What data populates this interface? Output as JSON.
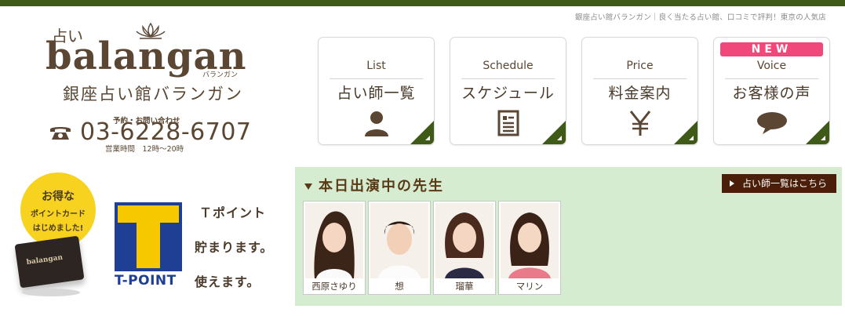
{
  "tagline": "銀座占い館バランガン｜良く当たる占い館、口コミで評判！東京の人気店",
  "logo": {
    "kanji_small": "占い",
    "word": "balangan",
    "kana": "バランガン",
    "jp_name": "銀座占い館バランガン"
  },
  "phone": {
    "label": "予約・お問い合わせ",
    "number": "03-6228-6707",
    "hours": "営業時間　12時～20時",
    "icon": "telephone-icon"
  },
  "nav": [
    {
      "en": "List",
      "jp": "占い師一覧",
      "icon": "person-icon"
    },
    {
      "en": "Schedule",
      "jp": "スケジュール",
      "icon": "document-icon"
    },
    {
      "en": "Price",
      "jp": "料金案内",
      "icon": "yen-icon"
    },
    {
      "en": "Voice",
      "jp": "お客様の声",
      "icon": "speech-bubble-icon",
      "badge": "NEW"
    }
  ],
  "promo": {
    "bubble_line1": "お得な",
    "bubble_line2": "ポイントカード",
    "bubble_line3": "はじめました!",
    "card_text": "balangan",
    "tpoint_label": "T-POINT",
    "text1": "Ｔポイント",
    "text2": "貯まります。",
    "text3": "使えます。"
  },
  "today": {
    "heading": "本日出演中の先生",
    "list_button": "占い師一覧はこちら",
    "tellers": [
      {
        "name": "西原さゆり"
      },
      {
        "name": "想"
      },
      {
        "name": "瑠華"
      },
      {
        "name": "マリン"
      }
    ]
  },
  "colors": {
    "header_bar": "#3f5a16",
    "brand_brown": "#5a4632",
    "new_badge": "#f0487a",
    "today_bg": "#d6ecd0",
    "list_btn": "#4a1e08",
    "tpoint_blue": "#1f3f95",
    "tpoint_yellow": "#f6c800"
  }
}
